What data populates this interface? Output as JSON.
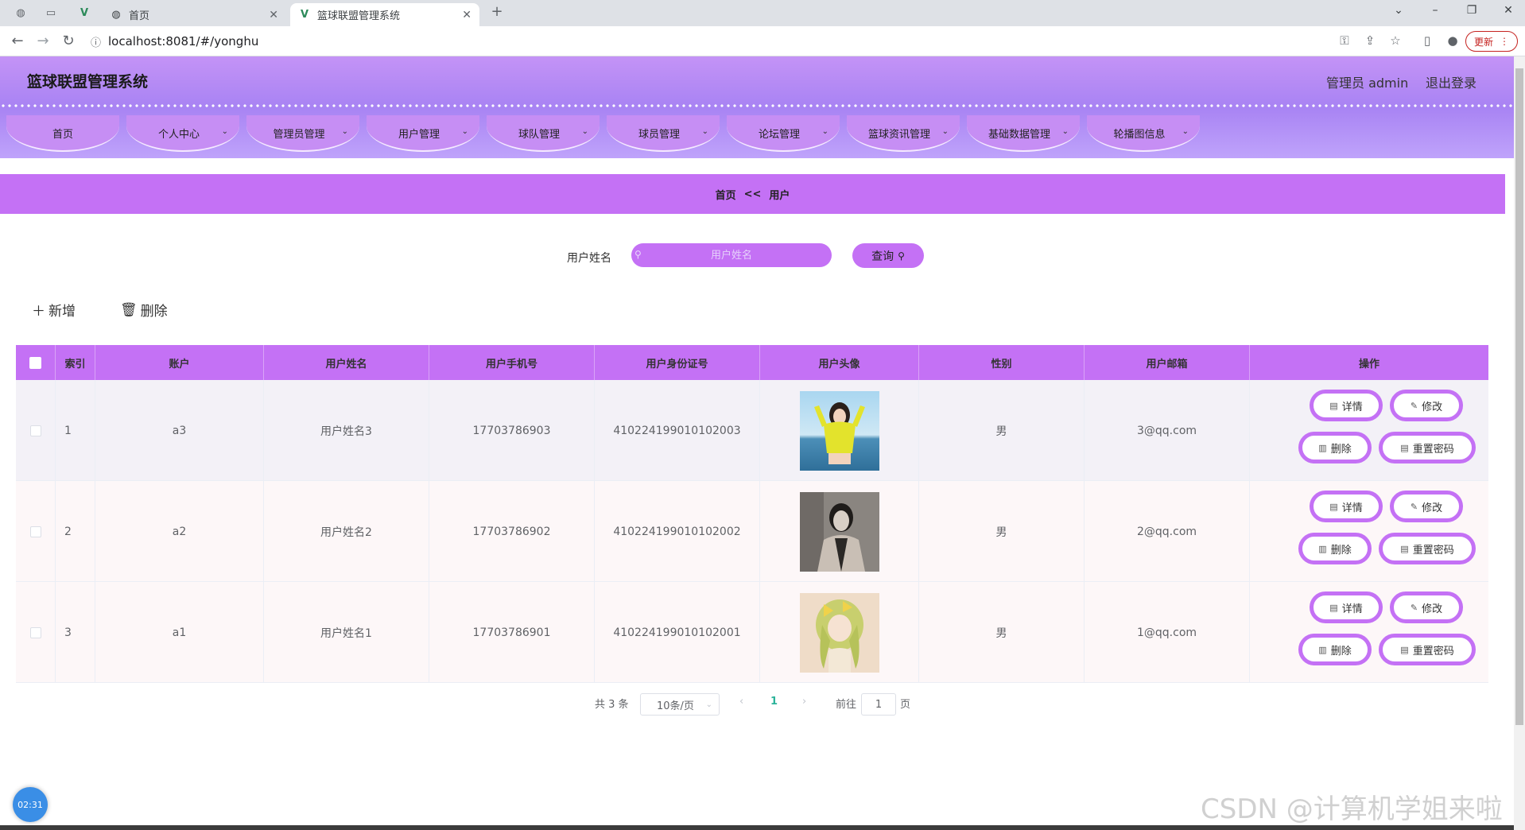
{
  "browser": {
    "tabs": [
      {
        "title": "首页",
        "active": false
      },
      {
        "title": "篮球联盟管理系统",
        "active": true
      }
    ],
    "url": "localhost:8081/#/yonghu",
    "update_label": "更新"
  },
  "header": {
    "title": "篮球联盟管理系统",
    "user": "管理员 admin",
    "logout": "退出登录"
  },
  "menu": [
    {
      "label": "首页",
      "dropdown": false
    },
    {
      "label": "个人中心",
      "dropdown": true
    },
    {
      "label": "管理员管理",
      "dropdown": true
    },
    {
      "label": "用户管理",
      "dropdown": true
    },
    {
      "label": "球队管理",
      "dropdown": true
    },
    {
      "label": "球员管理",
      "dropdown": true
    },
    {
      "label": "论坛管理",
      "dropdown": true
    },
    {
      "label": "篮球资讯管理",
      "dropdown": true
    },
    {
      "label": "基础数据管理",
      "dropdown": true
    },
    {
      "label": "轮播图信息",
      "dropdown": true
    }
  ],
  "breadcrumb": {
    "home": "首页",
    "sep": "<<",
    "current": "用户"
  },
  "search": {
    "label": "用户姓名",
    "placeholder": "用户姓名",
    "button": "查询"
  },
  "actions": {
    "add": "新增",
    "delete": "删除"
  },
  "table": {
    "columns": [
      "索引",
      "账户",
      "用户姓名",
      "用户手机号",
      "用户身份证号",
      "用户头像",
      "性别",
      "用户邮箱",
      "操作"
    ],
    "rows": [
      {
        "index": "1",
        "account": "a3",
        "name": "用户姓名3",
        "phone": "17703786903",
        "id_card": "410224199010102003",
        "gender": "男",
        "email": "3@qq.com"
      },
      {
        "index": "2",
        "account": "a2",
        "name": "用户姓名2",
        "phone": "17703786902",
        "id_card": "410224199010102002",
        "gender": "男",
        "email": "2@qq.com"
      },
      {
        "index": "3",
        "account": "a1",
        "name": "用户姓名1",
        "phone": "17703786901",
        "id_card": "410224199010102001",
        "gender": "男",
        "email": "1@qq.com"
      }
    ],
    "ops": {
      "detail": "详情",
      "edit": "修改",
      "delete": "删除",
      "reset": "重置密码"
    }
  },
  "pagination": {
    "total": "共 3 条",
    "page_size": "10条/页",
    "current": "1",
    "goto": "前往",
    "goto_value": "1",
    "page_unit": "页"
  },
  "clock": "02:31",
  "watermark": "CSDN @计算机学姐来啦",
  "colors": {
    "accent": "#c471f5",
    "header": "#a883f3"
  }
}
